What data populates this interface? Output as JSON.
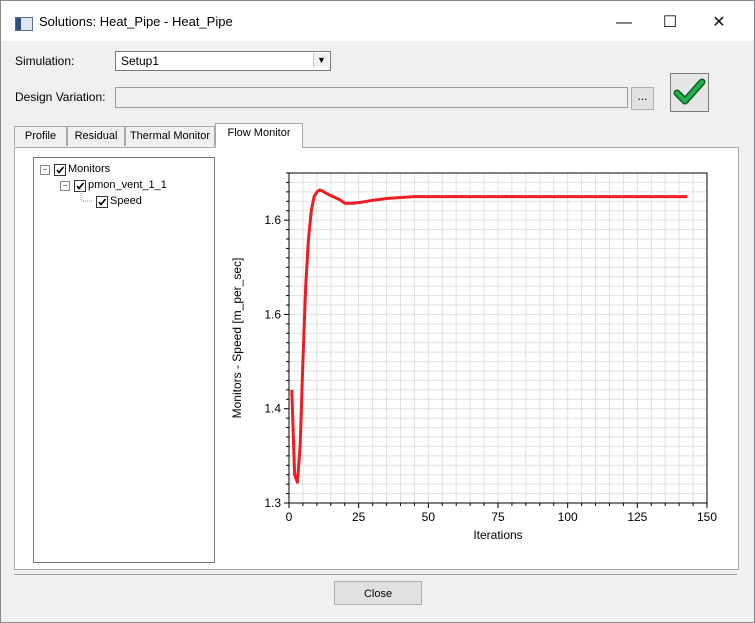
{
  "window": {
    "title": "Solutions: Heat_Pipe - Heat_Pipe",
    "minimize_glyph": "—",
    "maximize_glyph": "☐",
    "close_glyph": "✕"
  },
  "form": {
    "simulation_label": "Simulation:",
    "simulation_value": "Setup1",
    "design_variation_label": "Design Variation:",
    "design_variation_value": "",
    "browse_label": "..."
  },
  "tabs": [
    {
      "label": "Profile"
    },
    {
      "label": "Residual"
    },
    {
      "label": "Thermal Monitor"
    },
    {
      "label": "Flow Monitor",
      "active": true
    }
  ],
  "tree": {
    "root": {
      "label": "Monitors",
      "checked": true,
      "expander": "−"
    },
    "child": {
      "label": "pmon_vent_1_1",
      "checked": true,
      "expander": "−"
    },
    "leaf": {
      "label": "Speed",
      "checked": true
    }
  },
  "footer": {
    "close_label": "Close"
  },
  "icons": {
    "app": "app-window-icon",
    "status": "green-checkmark-icon",
    "expander": "tree-expander-icon",
    "checkbox": "checkbox-checked-icon"
  },
  "colors": {
    "series": "#ee1c25",
    "check": "#22b14c",
    "grid": "#e0e0e0"
  },
  "chart_data": {
    "type": "line",
    "title": "",
    "xlabel": "Iterations",
    "ylabel": "Monitors - Speed [m_per_sec]",
    "xlim": [
      0,
      150
    ],
    "ylim": [
      1.3,
      1.65
    ],
    "grid": true,
    "x_ticks": [
      0,
      25,
      50,
      75,
      100,
      125,
      150
    ],
    "x_tick_labels": [
      "0",
      "25",
      "50",
      "75",
      "100",
      "125",
      "150"
    ],
    "y_ticks": [
      1.3,
      1.4,
      1.5,
      1.6
    ],
    "y_tick_labels": [
      "1.3",
      "1.4",
      "1.6",
      "1.6"
    ],
    "series": [
      {
        "x": [
          1,
          2,
          3,
          4,
          5,
          6,
          7,
          8,
          9,
          10,
          11,
          12,
          13,
          15,
          18,
          20,
          23,
          26,
          30,
          35,
          40,
          45,
          50,
          60,
          70,
          80,
          100,
          120,
          143
        ],
        "y": [
          1.42,
          1.33,
          1.322,
          1.36,
          1.45,
          1.53,
          1.58,
          1.61,
          1.625,
          1.63,
          1.632,
          1.631,
          1.629,
          1.626,
          1.622,
          1.618,
          1.618,
          1.619,
          1.621,
          1.623,
          1.624,
          1.625,
          1.625,
          1.625,
          1.625,
          1.625,
          1.625,
          1.625,
          1.625
        ]
      }
    ]
  }
}
